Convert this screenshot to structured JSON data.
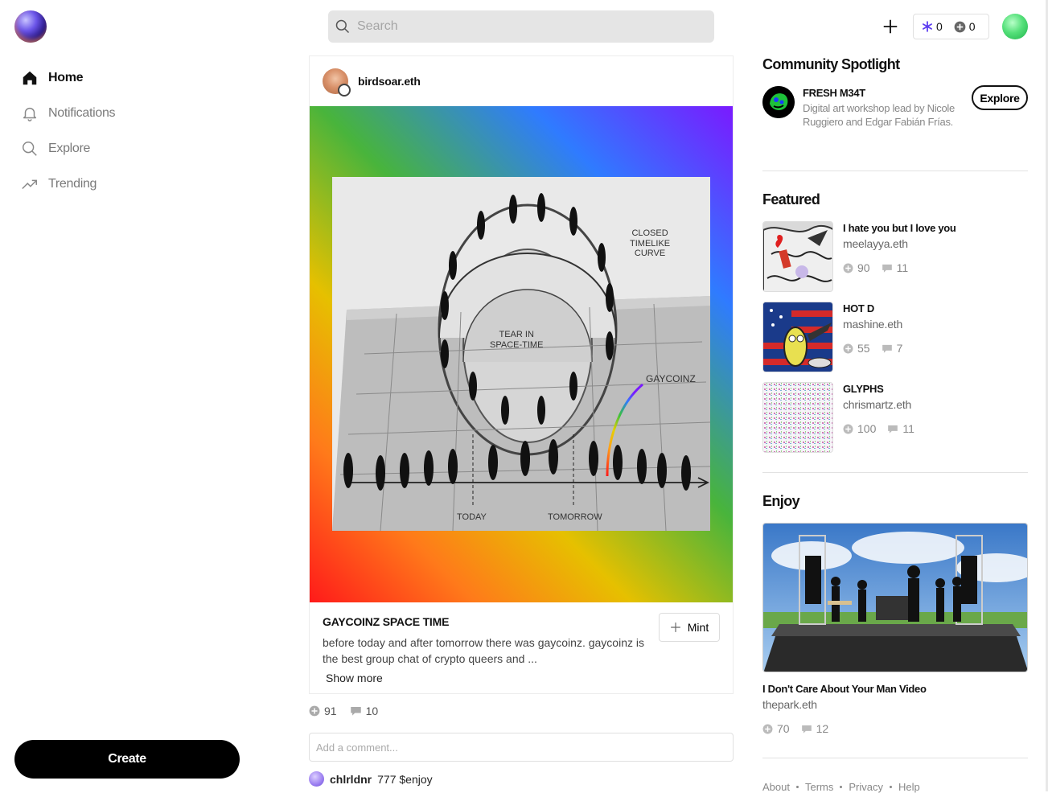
{
  "nav": {
    "items": [
      {
        "label": "Home",
        "icon": "home-icon",
        "active": true
      },
      {
        "label": "Notifications",
        "icon": "bell-icon",
        "active": false
      },
      {
        "label": "Explore",
        "icon": "search-icon",
        "active": false
      },
      {
        "label": "Trending",
        "icon": "trending-icon",
        "active": false
      }
    ],
    "create_label": "Create"
  },
  "search": {
    "placeholder": "Search",
    "value": ""
  },
  "header": {
    "snowflake_count": "0",
    "coin_count": "0",
    "accent": "#5b3bf0"
  },
  "post": {
    "username": "birdsoar.eth",
    "artwork_labels": {
      "closed_curve": "CLOSED\nTIMELIKE\nCURVE",
      "tear": "TEAR IN\nSPACE-TIME",
      "gaycoinz": "GAYCOINZ",
      "today": "TODAY",
      "tomorrow": "TOMORROW"
    },
    "title": "GAYCOINZ SPACE TIME",
    "description": "before today and after tomorrow there was gaycoinz. gaycoinz is the best group chat of crypto queers and ...",
    "show_more": "Show more",
    "mint_label": "Mint",
    "mints": "91",
    "comments": "10",
    "comment_placeholder": "Add a comment...",
    "latest_comment": {
      "user": "chlrldnr",
      "text": "777 $enjoy"
    }
  },
  "spotlight": {
    "heading": "Community Spotlight",
    "name": "FRESH M34T",
    "description": "Digital art workshop lead by Nicole Ruggiero and Edgar Fabián Frías.",
    "button": "Explore"
  },
  "featured": {
    "heading": "Featured",
    "items": [
      {
        "title": "I hate you but I love you",
        "author": "meelayya.eth",
        "mints": "90",
        "comments": "11"
      },
      {
        "title": "HOT D",
        "author": "mashine.eth",
        "mints": "55",
        "comments": "7"
      },
      {
        "title": "GLYPHS",
        "author": "chrismartz.eth",
        "mints": "100",
        "comments": "11"
      }
    ]
  },
  "enjoy": {
    "heading": "Enjoy",
    "title": "I Don't Care About Your Man Video",
    "author": "thepark.eth",
    "mints": "70",
    "comments": "12"
  },
  "footer": {
    "links": [
      "About",
      "Terms",
      "Privacy",
      "Help"
    ]
  }
}
